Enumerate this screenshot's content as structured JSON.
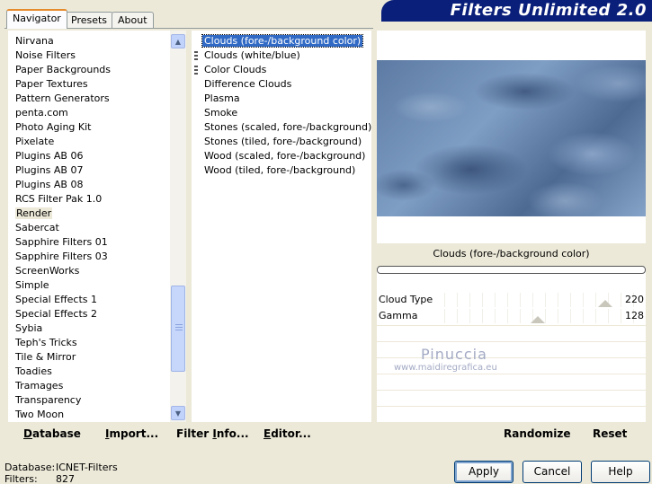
{
  "tabs": [
    {
      "label": "Navigator",
      "active": true
    },
    {
      "label": "Presets",
      "active": false
    },
    {
      "label": "About",
      "active": false
    }
  ],
  "banner": {
    "title": "Filters Unlimited 2.0"
  },
  "categories": {
    "items": [
      "Nirvana",
      "Noise Filters",
      "Paper Backgrounds",
      "Paper Textures",
      "Pattern Generators",
      "penta.com",
      "Photo Aging Kit",
      "Pixelate",
      "Plugins AB 06",
      "Plugins AB 07",
      "Plugins AB 08",
      "RCS Filter Pak 1.0",
      "Render",
      "Sabercat",
      "Sapphire Filters 01",
      "Sapphire Filters 03",
      "ScreenWorks",
      "Simple",
      "Special Effects 1",
      "Special Effects 2",
      "Sybia",
      "Teph's Tricks",
      "Tile & Mirror",
      "Toadies",
      "Tramages",
      "Transparency",
      "Two Moon"
    ],
    "selected": "Render"
  },
  "filters": {
    "items": [
      {
        "label": "Clouds (fore-/background color)",
        "marker": false,
        "selected": true
      },
      {
        "label": "Clouds (white/blue)",
        "marker": true,
        "selected": false
      },
      {
        "label": "Color Clouds",
        "marker": true,
        "selected": false
      },
      {
        "label": "Difference Clouds",
        "marker": false,
        "selected": false
      },
      {
        "label": "Plasma",
        "marker": false,
        "selected": false
      },
      {
        "label": "Smoke",
        "marker": false,
        "selected": false
      },
      {
        "label": "Stones (scaled, fore-/background)",
        "marker": false,
        "selected": false
      },
      {
        "label": "Stones (tiled, fore-/background)",
        "marker": false,
        "selected": false
      },
      {
        "label": "Wood (scaled, fore-/background)",
        "marker": false,
        "selected": false
      },
      {
        "label": "Wood (tiled, fore-/background)",
        "marker": false,
        "selected": false
      }
    ]
  },
  "preview": {
    "title": "Clouds (fore-/background color)"
  },
  "params": [
    {
      "label": "Cloud Type",
      "value": "220",
      "level": 220,
      "max": 255
    },
    {
      "label": "Gamma",
      "value": "128",
      "level": 128,
      "max": 255
    }
  ],
  "watermark": {
    "line1": "Pinuccia",
    "line2": "www.maidiregrafica.eu"
  },
  "toolbar": {
    "database": {
      "u": "D",
      "rest": "atabase"
    },
    "import": {
      "u": "I",
      "rest": "mport..."
    },
    "filter_info": {
      "pre": "Filter ",
      "u": "I",
      "rest": "nfo..."
    },
    "editor": {
      "u": "E",
      "rest": "ditor..."
    },
    "randomize": "Randomize",
    "reset": "Reset"
  },
  "status": {
    "database_label": "Database:",
    "database_value": "ICNET-Filters",
    "filters_label": "Filters:",
    "filters_value": "827"
  },
  "buttons": {
    "apply": "Apply",
    "cancel": "Cancel",
    "help": "Help"
  },
  "colors": {
    "banner": "#0a1f7a",
    "selection": "#316ac5",
    "dialog_bg": "#ece9d8"
  }
}
